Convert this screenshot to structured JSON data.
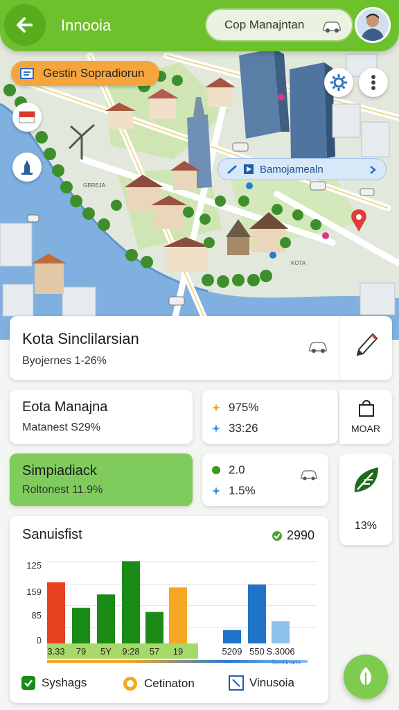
{
  "header": {
    "title": "Innooia",
    "company": "Cop Manajntan",
    "back_icon": "arrow-left-icon",
    "vehicle_icon": "car-icon"
  },
  "map": {
    "layer_chip": "Gestin Sopradiorun",
    "district_chip": "Bamojamealn",
    "labels": {
      "tower": "KOTA",
      "church": "GEREJA"
    }
  },
  "summary_card": {
    "title": "Kota Sinclilarsian",
    "subtitle": "Byojernes 1-26%"
  },
  "manage_card": {
    "title": "Eota Manajna",
    "subtitle": "Matanest S29%"
  },
  "stats_card_1": {
    "row1": "975%",
    "row2": "33:26"
  },
  "more_card": {
    "label": "MOAR"
  },
  "simple_card": {
    "title": "Simpiadiack",
    "subtitle": "Roltonest 11.9%"
  },
  "stats_card_2": {
    "row1": "2.0",
    "row2": "1.5%"
  },
  "eco_card": {
    "value": "13%"
  },
  "chart": {
    "title": "Sanuisfist",
    "badge": "2990",
    "xnote": "Senfilnans",
    "legend": [
      {
        "label": "Syshags"
      },
      {
        "label": "Cetinaton"
      },
      {
        "label": "Vinusoia"
      }
    ]
  },
  "chart_data": {
    "type": "bar",
    "title": "Sanuisfist",
    "ytick_labels": [
      "125",
      "159",
      "85",
      "0"
    ],
    "categories": [
      "3.33",
      "79",
      "5Y",
      "9:28",
      "57",
      "19",
      "5209",
      "550",
      "S.3006"
    ],
    "series": [
      {
        "color": "#e8411f",
        "points": [
          {
            "x": 0,
            "y": 105
          }
        ]
      },
      {
        "color": "#1a8b17",
        "points": [
          {
            "x": 1,
            "y": 61
          },
          {
            "x": 2,
            "y": 84
          },
          {
            "x": 3,
            "y": 141
          },
          {
            "x": 4,
            "y": 54
          }
        ]
      },
      {
        "color": "#f5a623",
        "points": [
          {
            "x": 5,
            "y": 96
          }
        ]
      },
      {
        "color": "#1f74c7",
        "points": [
          {
            "x": 6,
            "y": 23
          },
          {
            "x": 7,
            "y": 101
          }
        ]
      },
      {
        "color": "#8ec0ec",
        "points": [
          {
            "x": 8,
            "y": 38
          }
        ]
      }
    ],
    "ylim": [
      0,
      145
    ],
    "grid": true,
    "legend": "bottom"
  },
  "colors": {
    "brand": "#6cc12c",
    "accent_orange": "#f6a53c",
    "chart_green": "#1a8b17",
    "chart_red": "#e8411f",
    "chart_blue": "#1f74c7"
  }
}
